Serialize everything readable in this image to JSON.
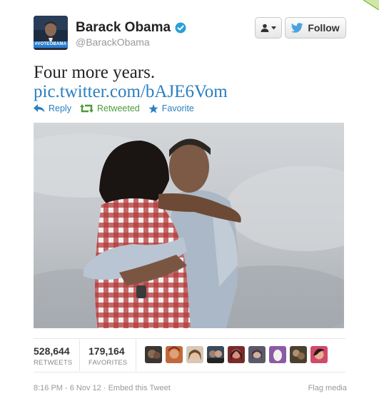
{
  "tweet": {
    "author": {
      "name": "Barack Obama",
      "handle": "@BarackObama",
      "avatar_caption": "#VOTEOBAMA",
      "verified_color": "#2a9fd8"
    },
    "buttons": {
      "user_menu_icon": "person-icon",
      "follow_label": "Follow",
      "follow_icon": "bird-icon"
    },
    "text": "Four more years.",
    "link": "pic.twitter.com/bAJE6Vom",
    "actions": {
      "reply": "Reply",
      "retweet": "Retweeted",
      "favorite": "Favorite"
    },
    "stats": {
      "retweets_value": "528,644",
      "retweets_label": "RETWEETS",
      "favorites_value": "179,164",
      "favorites_label": "FAVORITES"
    },
    "favoriters": [
      "face-1",
      "face-2",
      "face-3",
      "face-4",
      "face-5",
      "face-6",
      "face-7",
      "face-8",
      "face-9"
    ],
    "footer": {
      "timestamp": "8:16 PM - 6 Nov 12",
      "separator": " · ",
      "embed": "Embed this Tweet",
      "flag": "Flag media"
    },
    "colors": {
      "link": "#2a7fc0",
      "retweeted": "#4c9a3a",
      "muted": "#999999"
    }
  }
}
